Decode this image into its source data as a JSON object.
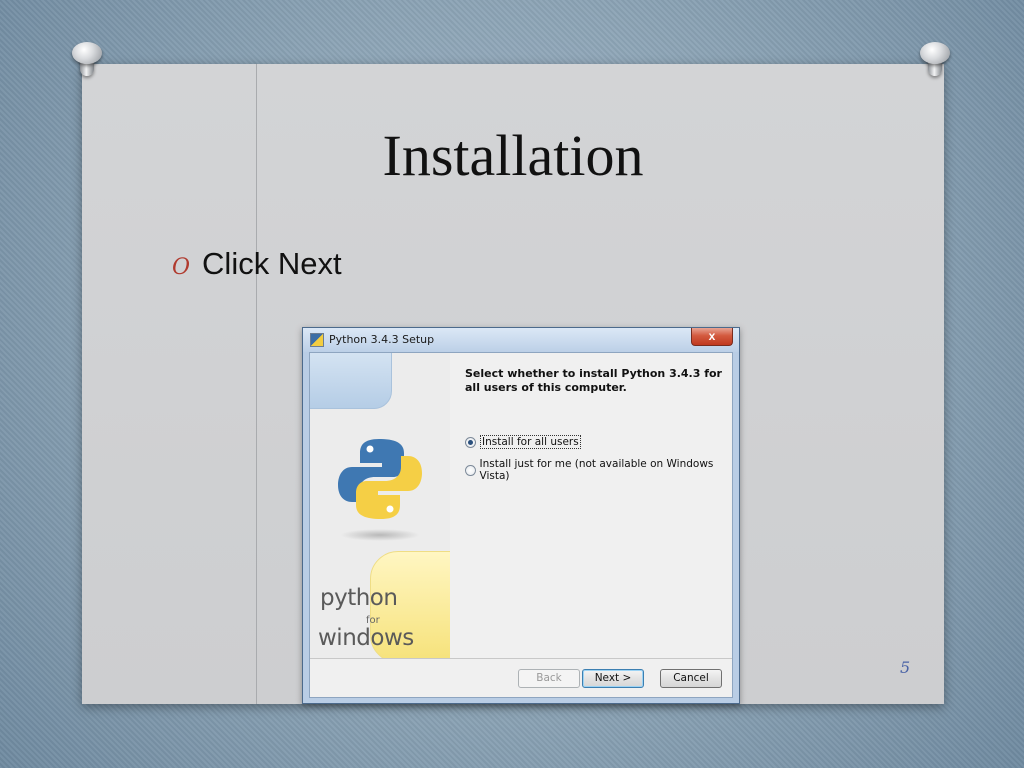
{
  "slide": {
    "title": "Installation",
    "bullet_mark": "O",
    "bullet": "Click Next",
    "page_number": "5"
  },
  "setup_window": {
    "title": "Python 3.4.3 Setup",
    "close_glyph": "x",
    "question": "Select whether to install Python 3.4.3 for all users of this computer.",
    "options": [
      {
        "label": "Install for all users",
        "selected": true
      },
      {
        "label": "Install just for me (not available on Windows Vista)",
        "selected": false
      }
    ],
    "branding": {
      "line1": "python",
      "line2": "for",
      "line3": "windows"
    },
    "buttons": {
      "back": "Back",
      "next": "Next >",
      "cancel": "Cancel"
    },
    "colors": {
      "python_blue": "#3f78b2",
      "python_yellow": "#f5cf45"
    }
  }
}
